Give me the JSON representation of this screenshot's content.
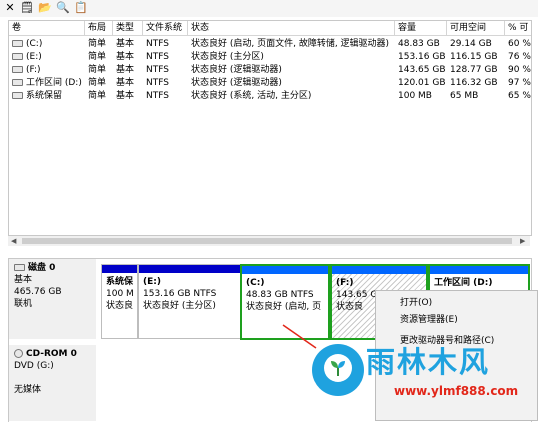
{
  "toolbar": {
    "close": "✕",
    "properties": "🗒",
    "open": "📂",
    "view": "🔍",
    "help": "📋",
    "icons": [
      "close-icon",
      "properties-icon",
      "open-folder-icon",
      "zoom-icon",
      "help-icon"
    ]
  },
  "volume_table": {
    "columns": [
      "卷",
      "布局",
      "类型",
      "文件系统",
      "状态",
      "容量",
      "可用空间",
      "% 可"
    ],
    "rows": [
      {
        "volume": "(C:)",
        "layout": "简单",
        "type": "基本",
        "fs": "NTFS",
        "status": "状态良好 (启动, 页面文件, 故障转储, 逻辑驱动器)",
        "capacity": "48.83 GB",
        "free": "29.14 GB",
        "pct": "60 %"
      },
      {
        "volume": "(E:)",
        "layout": "简单",
        "type": "基本",
        "fs": "NTFS",
        "status": "状态良好 (主分区)",
        "capacity": "153.16 GB",
        "free": "116.15 GB",
        "pct": "76 %"
      },
      {
        "volume": "(F:)",
        "layout": "简单",
        "type": "基本",
        "fs": "NTFS",
        "status": "状态良好 (逻辑驱动器)",
        "capacity": "143.65 GB",
        "free": "128.77 GB",
        "pct": "90 %"
      },
      {
        "volume": "工作区间 (D:)",
        "layout": "简单",
        "type": "基本",
        "fs": "NTFS",
        "status": "状态良好 (逻辑驱动器)",
        "capacity": "120.01 GB",
        "free": "116.32 GB",
        "pct": "97 %"
      },
      {
        "volume": "系统保留",
        "layout": "简单",
        "type": "基本",
        "fs": "NTFS",
        "status": "状态良好 (系统, 活动, 主分区)",
        "capacity": "100 MB",
        "free": "65 MB",
        "pct": "65 %"
      }
    ]
  },
  "disks": [
    {
      "name": "磁盘 0",
      "type": "基本",
      "size": "465.76 GB",
      "state": "联机"
    },
    {
      "name": "CD-ROM 0",
      "type": "DVD (G:)",
      "size": "",
      "state": "无媒体"
    }
  ],
  "partitions": [
    {
      "title": "系统保",
      "line1": "100 M",
      "line2": "状态良"
    },
    {
      "title": "(E:)",
      "line1": "153.16 GB NTFS",
      "line2": "状态良好 (主分区)"
    },
    {
      "title": "(C:)",
      "line1": "48.83 GB NTFS",
      "line2": "状态良好 (启动, 页"
    },
    {
      "title": "(F:)",
      "line1": "143.65 G",
      "line2": "状态良"
    },
    {
      "title": "工作区间  (D:)",
      "line1": "",
      "line2": ""
    }
  ],
  "context_menu": {
    "items": [
      "打开(O)",
      "资源管理器(E)",
      "更改驱动器号和路径(C)"
    ]
  },
  "watermark": {
    "brand": "雨林木风",
    "url": "www.ylmf888.com"
  },
  "colors": {
    "partition_header": "#0000c8",
    "selection": "#1ea01e",
    "logo_blue": "#1fa2df",
    "url_red": "#e2271a"
  }
}
